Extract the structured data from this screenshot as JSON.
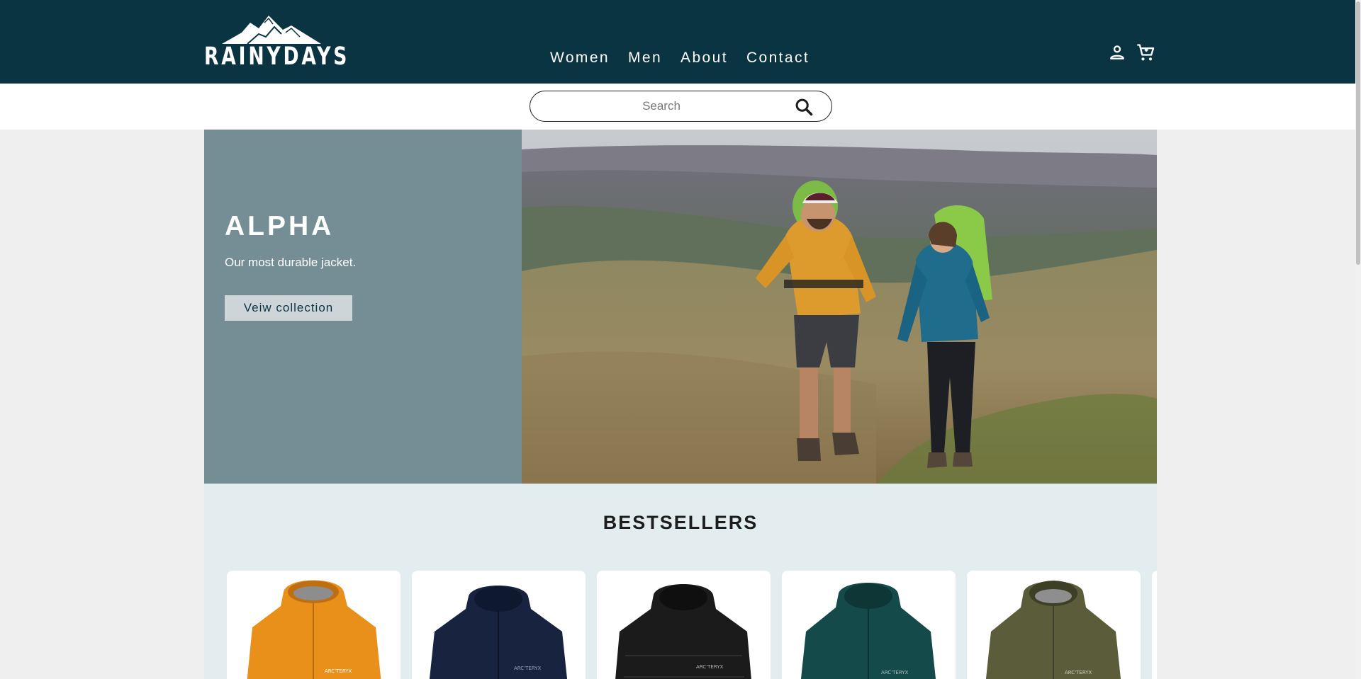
{
  "brand": {
    "name": "RAINYDAYS"
  },
  "nav": {
    "items": [
      {
        "label": "Women"
      },
      {
        "label": "Men"
      },
      {
        "label": "About"
      },
      {
        "label": "Contact"
      }
    ]
  },
  "header_icons": [
    "account-icon",
    "cart-icon"
  ],
  "search": {
    "placeholder": "Search"
  },
  "hero": {
    "title": "ALPHA",
    "subtitle": "Our most durable jacket.",
    "button_label": "Veiw collection"
  },
  "bestsellers": {
    "title": "BESTSELLERS",
    "products": [
      {
        "color": "#e9901a"
      },
      {
        "color": "#17233f"
      },
      {
        "color": "#1b1b1b"
      },
      {
        "color": "#154a4a"
      },
      {
        "color": "#5b5d3a"
      }
    ]
  },
  "colors": {
    "header_bg": "#0b3442",
    "hero_panel_bg": "#758e96",
    "hero_button_bg": "#cdd5d8",
    "bestsellers_bg": "#e3edef",
    "page_bg": "#efefef"
  }
}
